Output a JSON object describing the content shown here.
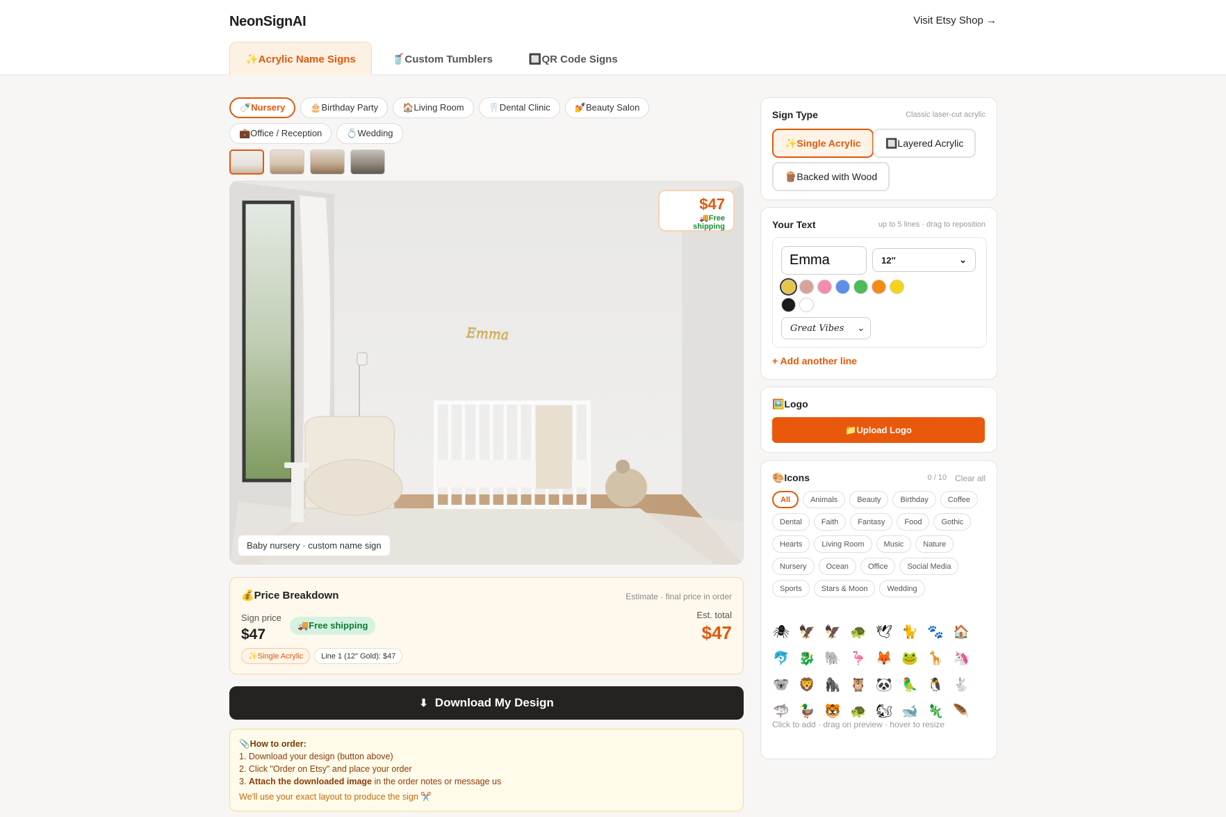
{
  "header": {
    "brand": "NeonSignAI",
    "etsy_link": "Visit Etsy Shop →",
    "tabs": [
      {
        "label": "✨Acrylic Name Signs",
        "active": true
      },
      {
        "label": "🥤Custom Tumblers",
        "active": false
      },
      {
        "label": "🔲QR Code Signs",
        "active": false
      }
    ]
  },
  "rooms": [
    "🍼Nursery",
    "🎂Birthday Party",
    "🏠Living Room",
    "🦷Dental Clinic",
    "💅Beauty Salon",
    "💼Office / Reception",
    "💍Wedding"
  ],
  "preview": {
    "sign_text": "Emma",
    "price": "$47",
    "shipping": "🚚Free shipping",
    "caption": "Baby nursery · custom name sign"
  },
  "price_breakdown": {
    "title": "💰Price Breakdown",
    "note": "Estimate · final price in order",
    "sign_label": "Sign price",
    "sign_value": "$47",
    "free_shipping": "🚚Free shipping",
    "total_label": "Est. total",
    "total_value": "$47",
    "tags": [
      "✨Single Acrylic",
      "Line 1 (12″ Gold): $47"
    ]
  },
  "download": {
    "label": "Download My Design"
  },
  "how_to": {
    "title": "📎How to order:",
    "step1": "1. Download your design (button above)",
    "step2": "2. Click \"Order on Etsy\" and place your order",
    "step3_prefix": "3. ",
    "step3_bold": "Attach the downloaded image",
    "step3_rest": " in the order notes or message us",
    "footer": "We'll use your exact layout to produce the sign ✂️"
  },
  "sign_type": {
    "title": "Sign Type",
    "note": "Classic laser-cut acrylic",
    "options": [
      "✨Single Acrylic",
      "🔲Layered Acrylic",
      "🪵Backed with Wood"
    ]
  },
  "your_text": {
    "title": "Your Text",
    "note": "up to 5 lines · drag to reposition",
    "value": "Emma",
    "size": "12″",
    "font": "Great Vibes",
    "colors": [
      "#e8c44a",
      "#d9a39d",
      "#f28cb1",
      "#5c8fe8",
      "#4cbb5a",
      "#f58b12",
      "#f7d21a",
      "#1b1b1b",
      "#ffffff"
    ],
    "add_line": "+ Add another line"
  },
  "logo": {
    "title": "🖼️Logo",
    "upload": "📁Upload Logo"
  },
  "icons": {
    "title": "🎨Icons",
    "count": "0 / 10",
    "clear": "Clear all",
    "categories": [
      "All",
      "Animals",
      "Beauty",
      "Birthday",
      "Coffee",
      "Dental",
      "Faith",
      "Fantasy",
      "Food",
      "Gothic",
      "Hearts",
      "Living Room",
      "Music",
      "Nature",
      "Nursery",
      "Ocean",
      "Office",
      "Social Media",
      "Sports",
      "Stars & Moon",
      "Wedding"
    ],
    "glyphs": [
      "🕷",
      "🦅",
      "🦅",
      "🐢",
      "🕊",
      "🐈",
      "🐾",
      "🏠",
      "🐬",
      "🐉",
      "🐘",
      "🦩",
      "🦊",
      "🐸",
      "🦒",
      "🦄",
      "🐨",
      "🦁",
      "🦍",
      "🦉",
      "🐼",
      "🦜",
      "🐧",
      "🐇",
      "🦈",
      "🦆",
      "🐯",
      "🐢",
      "🐿",
      "🐋",
      "🦎",
      "🪶"
    ],
    "hint": "Click to add · drag on preview · hover to resize"
  }
}
